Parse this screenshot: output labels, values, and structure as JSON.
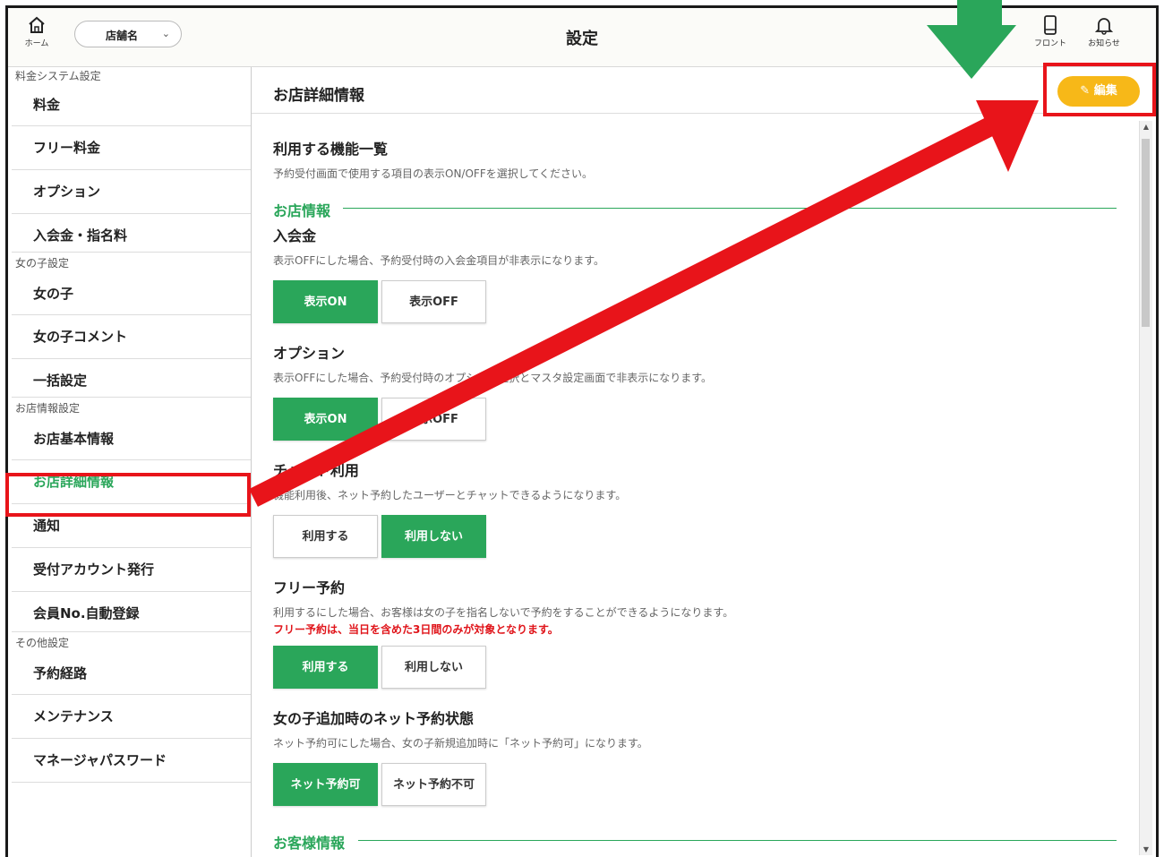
{
  "header": {
    "home_label": "ホーム",
    "store_select": "店舗名",
    "title": "設定",
    "front_label": "フロント",
    "notice_label": "お知らせ"
  },
  "sidebar": {
    "sections": [
      {
        "label": "料金システム設定",
        "items": [
          "料金",
          "フリー料金",
          "オプション",
          "入会金・指名料"
        ]
      },
      {
        "label": "女の子設定",
        "items": [
          "女の子",
          "女の子コメント",
          "一括設定"
        ]
      },
      {
        "label": "お店情報設定",
        "items": [
          "お店基本情報",
          "お店詳細情報",
          "通知",
          "受付アカウント発行",
          "会員No.自動登録"
        ]
      },
      {
        "label": "その他設定",
        "items": [
          "予約経路",
          "メンテナンス",
          "マネージャパスワード"
        ]
      }
    ],
    "active_item": "お店詳細情報"
  },
  "main": {
    "title": "お店詳細情報",
    "edit_label": "編集",
    "features_title": "利用する機能一覧",
    "features_desc": "予約受付画面で使用する項目の表示ON/OFFを選択してください。",
    "shop_info_heading": "お店情報",
    "customer_info_heading": "お客様情報",
    "settings": [
      {
        "title": "入会金",
        "desc": "表示OFFにした場合、予約受付時の入会金項目が非表示になります。",
        "note": "",
        "options": [
          "表示ON",
          "表示OFF"
        ],
        "selected": 0
      },
      {
        "title": "オプション",
        "desc": "表示OFFにした場合、予約受付時のオプション選択とマスタ設定画面で非表示になります。",
        "note": "",
        "options": [
          "表示ON",
          "表示OFF"
        ],
        "selected": 0
      },
      {
        "title": "チャット利用",
        "desc": "機能利用後、ネット予約したユーザーとチャットできるようになります。",
        "note": "",
        "options": [
          "利用する",
          "利用しない"
        ],
        "selected": 1
      },
      {
        "title": "フリー予約",
        "desc": "利用するにした場合、お客様は女の子を指名しないで予約をすることができるようになります。",
        "note": "フリー予約は、当日を含めた3日間のみが対象となります。",
        "options": [
          "利用する",
          "利用しない"
        ],
        "selected": 0
      },
      {
        "title": "女の子追加時のネット予約状態",
        "desc": "ネット予約可にした場合、女の子新規追加時に「ネット予約可」になります。",
        "note": "",
        "options": [
          "ネット予約可",
          "ネット予約不可"
        ],
        "selected": 0
      }
    ]
  },
  "colors": {
    "accent_green": "#2aa65a",
    "edit_yellow": "#f7b818",
    "annotation_red": "#e8141a",
    "annotation_green": "#2aa65a"
  }
}
